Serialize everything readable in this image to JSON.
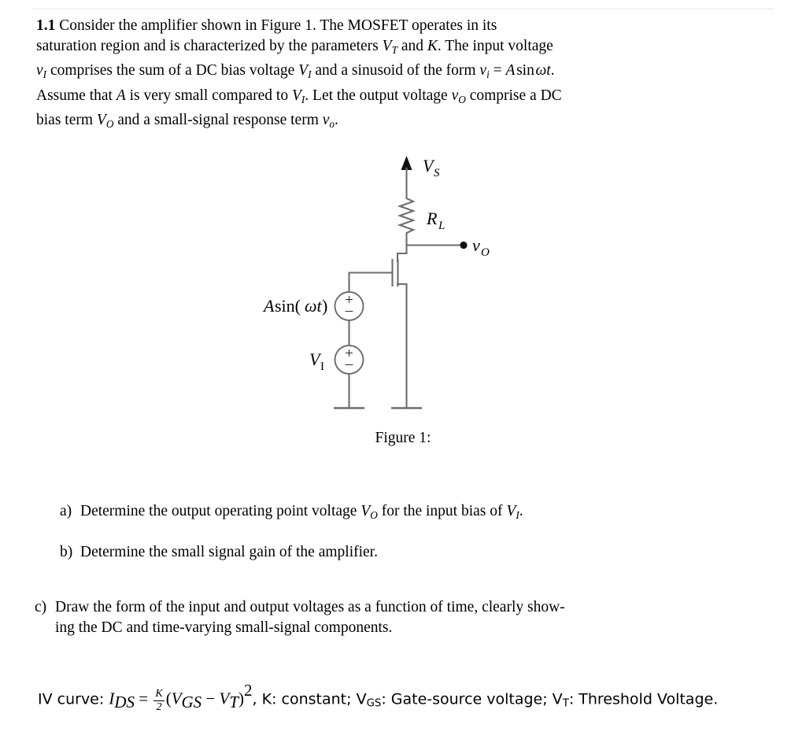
{
  "document": {
    "problem_number": "1.1",
    "intro_lines": [
      "Consider the amplifier shown in Figure 1. The MOSFET operates in its",
      "saturation region and is characterized by the parameters V_T and K. The input voltage",
      "v_I comprises the sum of a DC bias voltage V_I and a sinusoid of the form v_i = A sin wt.",
      "Assume that A is very small compared to V_I. Let the output voltage v_O comprise a DC",
      "bias term V_O and a small-signal response term v_o."
    ],
    "intro": {
      "l1_a": "Consider the amplifier shown in Figure 1. The MOSFET operates in its",
      "l2_a": "saturation region and is characterized by the parameters ",
      "l2_V": "V",
      "l2_Vsub": "T",
      "l2_b": " and ",
      "l2_K": "K",
      "l2_c": ". The input voltage",
      "l3_v": "v",
      "l3_vsub": "I",
      "l3_a": " comprises the sum of a DC bias voltage ",
      "l3_V": "V",
      "l3_Vsub": "I",
      "l3_b": " and a sinusoid of the form ",
      "l3_vi": "v",
      "l3_visub": "i",
      "l3_eq": " = ",
      "l3_A": "A",
      "l3_sin": "sin",
      "l3_wt": "ωt",
      "l3_dot": ".",
      "l4_a": "Assume that ",
      "l4_A": "A",
      "l4_b": " is very small compared to ",
      "l4_V": "V",
      "l4_Vsub": "I",
      "l4_c": ". Let the output voltage ",
      "l4_vo": "v",
      "l4_vosub": "O",
      "l4_d": " comprise a DC",
      "l5_a": "bias term ",
      "l5_V": "V",
      "l5_Vsub": "O",
      "l5_b": " and a small-signal response term ",
      "l5_v": "v",
      "l5_vsub": "o",
      "l5_c": "."
    },
    "figure_caption": "Figure 1:",
    "questions": [
      {
        "marker": "a)",
        "text_a": "Determine the output operating point voltage ",
        "V1": "V",
        "V1sub": "O",
        "text_b": " for the input bias of ",
        "V2": "V",
        "V2sub": "I",
        "text_c": "."
      },
      {
        "marker": "b)",
        "text_a": "Determine the small signal gain of the amplifier.",
        "V1": "",
        "V1sub": "",
        "text_b": "",
        "V2": "",
        "V2sub": "",
        "text_c": ""
      },
      {
        "marker": "c)",
        "line1": "Draw the form of the input and output voltages as a function of time, clearly show-",
        "line2": "ing the DC and time-varying small-signal components."
      }
    ],
    "iv_line": {
      "label": "IV curve: ",
      "I": "I",
      "Isub": "DS",
      "equals": " = ",
      "frac_num": "K",
      "frac_den": "2",
      "open": "(",
      "V_GS": "V",
      "V_GS_sub": "GS",
      "minus": " − ",
      "V_T": "V",
      "V_T_sub": "T",
      "close": ")",
      "power": "2",
      "rest": ", K: constant; V",
      "rest_sub1": "GS",
      "rest_b": ": Gate-source voltage; V",
      "rest_sub2": "T",
      "rest_c": ": Threshold Voltage."
    }
  },
  "circuit": {
    "labels": {
      "supply": "V",
      "supply_sub": "S",
      "resistor": "R",
      "resistor_sub": "L",
      "output": "v",
      "output_sub": "O",
      "ac_source": "A",
      "ac_source_sin": "sin(",
      "ac_source_omega": "ωt",
      "ac_source_close": ")",
      "dc_source": "V",
      "dc_source_sub": "I",
      "plus": "+",
      "minus": "–"
    },
    "colors": {
      "wire": "#6d6d6d",
      "text": "#000000",
      "background": "#ffffff"
    }
  }
}
